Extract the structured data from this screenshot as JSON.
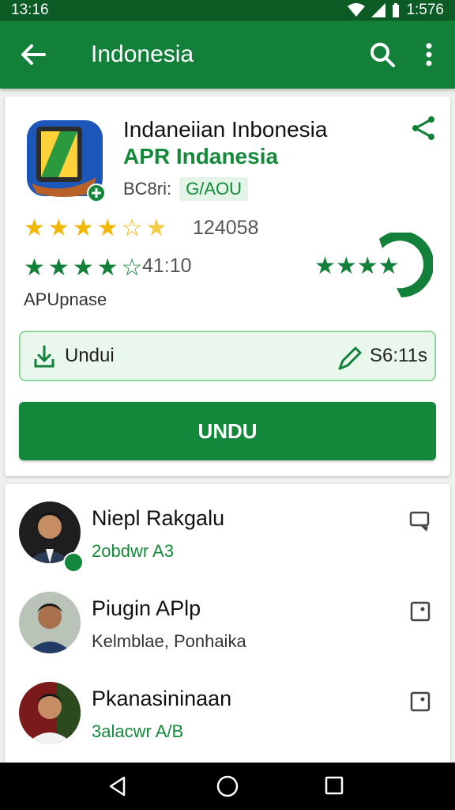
{
  "status_bar": {
    "time": "13:16",
    "battery": "1:576"
  },
  "app_bar": {
    "title": "Indonesia",
    "back_icon": "arrow-left-icon",
    "search_icon": "search-icon",
    "more_icon": "more-vert-icon"
  },
  "app": {
    "name": "Indaneiian Inbonesia",
    "subtitle": "APR Indanesia",
    "size_label": "BC8ri:",
    "size_value": "G/AOU",
    "rating_count_1": "124058",
    "rating_count_2": "41:10",
    "update_label": "APUpnase",
    "gold_rating": 4.5,
    "green_rating": 3.5
  },
  "download_strip": {
    "label": "Undui",
    "size": "S6:11s"
  },
  "install_button": {
    "label": "UNDU"
  },
  "list": [
    {
      "name": "Niepl Rakgalu",
      "sub": "2obdwr A3",
      "sub_color": "green",
      "action_icon": "cast-icon"
    },
    {
      "name": "Piugin APlp",
      "sub": "Kelmblae, Ponhaika",
      "sub_color": "gray",
      "action_icon": "square-dot-icon"
    },
    {
      "name": "Pkanasininaan",
      "sub": "3alacwr A/B",
      "sub_color": "green",
      "action_icon": "square-dot-icon"
    }
  ],
  "nav_bar": {
    "back_icon": "nav-back-icon",
    "home_icon": "nav-home-icon",
    "recent_icon": "nav-recent-icon"
  },
  "colors": {
    "app_bar": "#13803a",
    "accent": "#13873a",
    "star_gold": "#f2b705"
  }
}
